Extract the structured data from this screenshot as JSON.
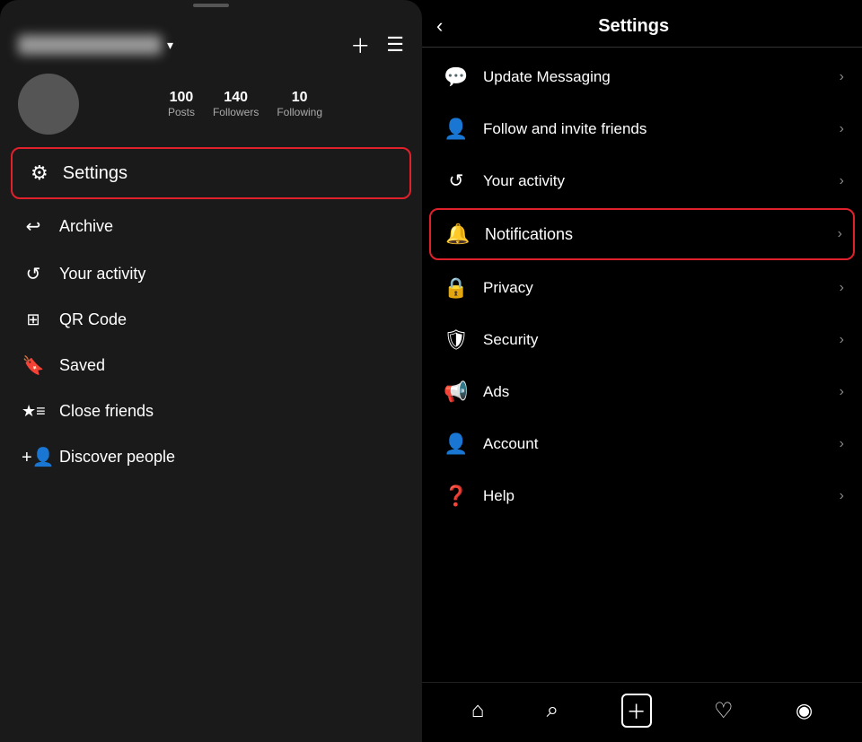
{
  "left": {
    "username_placeholder": "Username",
    "stats": [
      {
        "value": "100",
        "label": "Posts"
      },
      {
        "value": "140",
        "label": "Followers"
      },
      {
        "value": "10",
        "label": "Following"
      }
    ],
    "settings_item": {
      "icon": "⚙",
      "label": "Settings"
    },
    "menu_items": [
      {
        "icon": "↩",
        "label": "Archive",
        "name": "archive"
      },
      {
        "icon": "↺",
        "label": "Your activity",
        "name": "your-activity"
      },
      {
        "icon": "⊞",
        "label": "QR Code",
        "name": "qr-code"
      },
      {
        "icon": "🔖",
        "label": "Saved",
        "name": "saved"
      },
      {
        "icon": "✦",
        "label": "Close friends",
        "name": "close-friends"
      },
      {
        "icon": "⊕",
        "label": "Discover people",
        "name": "discover-people"
      }
    ]
  },
  "right": {
    "title": "Settings",
    "menu_items": [
      {
        "icon": "💬",
        "label": "Update Messaging",
        "name": "update-messaging",
        "highlighted": false
      },
      {
        "icon": "👤",
        "label": "Follow and invite friends",
        "name": "follow-invite-friends",
        "highlighted": false
      },
      {
        "icon": "↺",
        "label": "Your activity",
        "name": "your-activity",
        "highlighted": false
      },
      {
        "icon": "🔔",
        "label": "Notifications",
        "name": "notifications",
        "highlighted": true
      },
      {
        "icon": "🔒",
        "label": "Privacy",
        "name": "privacy",
        "highlighted": false
      },
      {
        "icon": "🛡",
        "label": "Security",
        "name": "security",
        "highlighted": false
      },
      {
        "icon": "📢",
        "label": "Ads",
        "name": "ads",
        "highlighted": false
      },
      {
        "icon": "👤",
        "label": "Account",
        "name": "account",
        "highlighted": false
      },
      {
        "icon": "❓",
        "label": "Help",
        "name": "help",
        "highlighted": false
      }
    ],
    "bottom_nav": [
      {
        "icon": "⌂",
        "name": "home-icon"
      },
      {
        "icon": "⌕",
        "name": "search-icon"
      },
      {
        "icon": "⊞",
        "name": "create-icon"
      },
      {
        "icon": "♡",
        "name": "heart-icon"
      },
      {
        "icon": "◉",
        "name": "profile-icon"
      }
    ]
  }
}
